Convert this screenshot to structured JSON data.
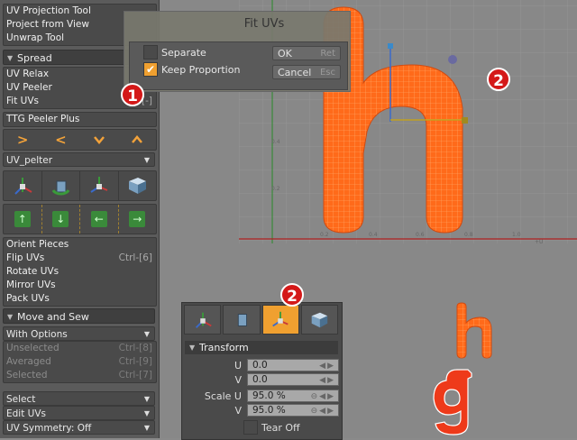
{
  "left_panel": {
    "top_items": [
      "UV Projection Tool",
      "Project from View",
      "Unwrap Tool"
    ],
    "spread_header": "Spread",
    "relax_items": [
      {
        "label": "UV Relax",
        "shortcut": ""
      },
      {
        "label": "UV Peeler",
        "shortcut": ""
      },
      {
        "label": "Fit UVs",
        "shortcut": "[-]"
      }
    ],
    "ttg_label": "TTG Peeler Plus",
    "arrows": [
      ">",
      "<",
      "v",
      "^"
    ],
    "uv_pelter_dropdown": "UV_pelter",
    "tool_icons": [
      "uv-transform-icon",
      "uv-rotate-icon",
      "uv-pin-icon",
      "uv-cube-icon"
    ],
    "green_buttons": [
      "↑",
      "↓",
      "←",
      "→"
    ],
    "piece_items": [
      {
        "label": "Orient Pieces",
        "shortcut": ""
      },
      {
        "label": "Flip UVs",
        "shortcut": "Ctrl-[6]"
      },
      {
        "label": "Rotate UVs",
        "shortcut": ""
      },
      {
        "label": "Mirror UVs",
        "shortcut": ""
      },
      {
        "label": "Pack UVs",
        "shortcut": ""
      }
    ],
    "move_sew_header": "Move and Sew",
    "with_options": "With Options",
    "sew_items": [
      {
        "label": "Unselected",
        "shortcut": "Ctrl-[8]"
      },
      {
        "label": "Averaged",
        "shortcut": "Ctrl-[9]"
      },
      {
        "label": "Selected",
        "shortcut": "Ctrl-[7]"
      }
    ],
    "bottom_dropdowns": [
      "Select",
      "Edit UVs",
      "UV Symmetry: Off"
    ]
  },
  "dialog": {
    "title": "Fit UVs",
    "separate_label": "Separate",
    "separate_checked": false,
    "keep_label": "Keep Proportion",
    "keep_checked": true,
    "ok_label": "OK",
    "ok_key": "Ret",
    "cancel_label": "Cancel",
    "cancel_key": "Esc"
  },
  "badges": {
    "b1": "1",
    "b2": "2",
    "b3": "2"
  },
  "viewport": {
    "axis_labels_y": [
      "0.4",
      "0.2"
    ],
    "axis_labels_x": [
      "0.2",
      "0.4",
      "0.6",
      "0.8",
      "1.0",
      "+U"
    ]
  },
  "transform_panel": {
    "tab_icons": [
      "uv-transform-icon",
      "uv-rotate-icon",
      "uv-pin-icon",
      "uv-cube-icon"
    ],
    "header": "Transform",
    "fields": [
      {
        "label": "U",
        "value": "0.0"
      },
      {
        "label": "V",
        "value": "0.0"
      },
      {
        "label": "Scale U",
        "value": "95.0 %"
      },
      {
        "label": "V",
        "value": "95.0 %"
      }
    ],
    "tear_off_label": "Tear Off"
  },
  "colors": {
    "accent": "#f0a030",
    "uv_fill": "#ff6a1a",
    "badge": "#d41818"
  }
}
